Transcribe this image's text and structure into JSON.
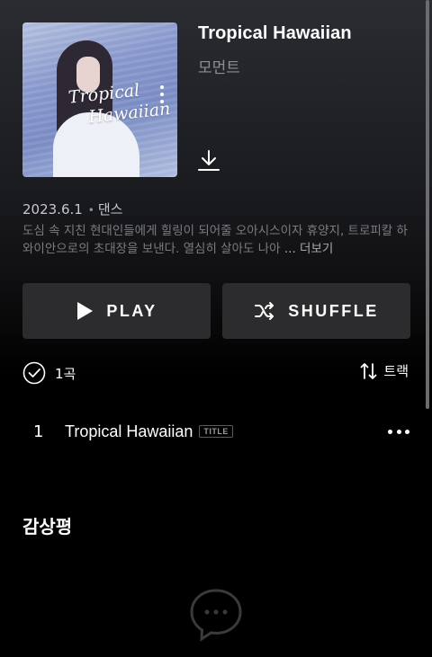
{
  "album": {
    "title": "Tropical Hawaiian",
    "artist": "모먼트",
    "cover_text_line1": "Tropical",
    "cover_text_line2": "Hawaiian",
    "release_date": "2023.6.1",
    "genre": "댄스",
    "description": "도심 속 지친 현대인들에게 힐링이 되어줄 오아시스이자 휴양지, 트로피칼 하와이안으로의 초대장을 보낸다. 열심히 살아도 나아",
    "more_label": "... 더보기"
  },
  "actions": {
    "play_label": "PLAY",
    "shuffle_label": "SHUFFLE"
  },
  "tracklist": {
    "count_label": "1곡",
    "sort_label": "트랙",
    "tracks": [
      {
        "number": "1",
        "title": "Tropical Hawaiian",
        "badge": "TITLE"
      }
    ]
  },
  "reviews": {
    "heading": "감상평"
  },
  "colors": {
    "button_bg": "#2c2c2e",
    "muted_text": "#8e8e93"
  }
}
